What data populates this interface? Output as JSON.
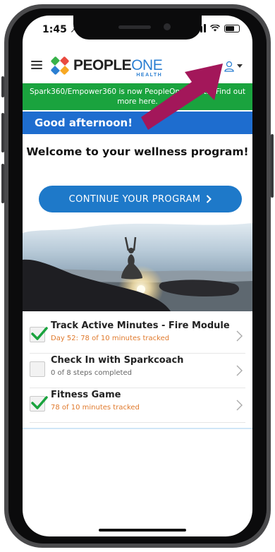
{
  "status_bar": {
    "time": "1:45"
  },
  "header": {
    "logo_people": "PEOPLE",
    "logo_one": "ONE",
    "logo_health": "HEALTH"
  },
  "banner": {
    "text": "Spark360/Empower360 is now PeopleOne Health. Find out more here."
  },
  "greeting": "Good afternoon!",
  "welcome": "Welcome to your wellness program!",
  "continue_button": {
    "label": "CONTINUE YOUR PROGRAM",
    "icon": "chevron-right-icon"
  },
  "activities": [
    {
      "title": "Track Active Minutes - Fire Module",
      "subtitle": "Day 52: 78 of 10 minutes tracked",
      "completed": true
    },
    {
      "title": "Check In with Sparkcoach",
      "subtitle": "0 of 8 steps completed",
      "completed": false
    },
    {
      "title": "Fitness Game",
      "subtitle": "78 of 10 minutes tracked",
      "completed": true
    }
  ],
  "colors": {
    "banner_green": "#1aa33e",
    "greeting_blue": "#1e6dcf",
    "button_blue": "#1e79c9",
    "check_green": "#1aa33e",
    "subtitle_orange": "#e07a2d",
    "arrow_magenta": "#a3175a"
  },
  "icons": [
    "menu-icon",
    "user-icon",
    "caret-down-icon",
    "check-icon",
    "chevron-right-icon"
  ]
}
